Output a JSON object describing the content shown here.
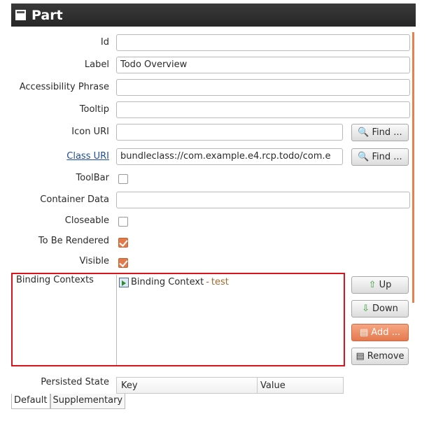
{
  "header": {
    "title": "Part",
    "icon": "window-icon"
  },
  "form": {
    "id": {
      "label": "Id",
      "value": ""
    },
    "label": {
      "label": "Label",
      "value": "Todo Overview"
    },
    "accessibility": {
      "label": "Accessibility Phrase",
      "value": ""
    },
    "tooltip": {
      "label": "Tooltip",
      "value": ""
    },
    "icon_uri": {
      "label": "Icon URI",
      "value": "",
      "find_label": "Find ..."
    },
    "class_uri": {
      "label": "Class URI",
      "value": "bundleclass://com.example.e4.rcp.todo/com.e",
      "find_label": "Find ..."
    },
    "toolbar": {
      "label": "ToolBar",
      "checked": false
    },
    "container_data": {
      "label": "Container Data",
      "value": ""
    },
    "closeable": {
      "label": "Closeable",
      "checked": false
    },
    "to_be_rendered": {
      "label": "To Be Rendered",
      "checked": true
    },
    "visible": {
      "label": "Visible",
      "checked": true
    }
  },
  "binding_contexts": {
    "label": "Binding Contexts",
    "items": [
      {
        "name": "Binding Context",
        "separator": " - ",
        "detail": "test"
      }
    ],
    "buttons": {
      "up": "Up",
      "down": "Down",
      "add": "Add ...",
      "remove": "Remove"
    }
  },
  "persisted_state": {
    "label": "Persisted State",
    "columns": [
      "Key",
      "Value"
    ]
  },
  "tabs": [
    "Default",
    "Supplementary"
  ],
  "colors": {
    "accent": "#e27b4b",
    "highlight_border": "#d9141d",
    "header_bg": "#2e2e2e"
  }
}
